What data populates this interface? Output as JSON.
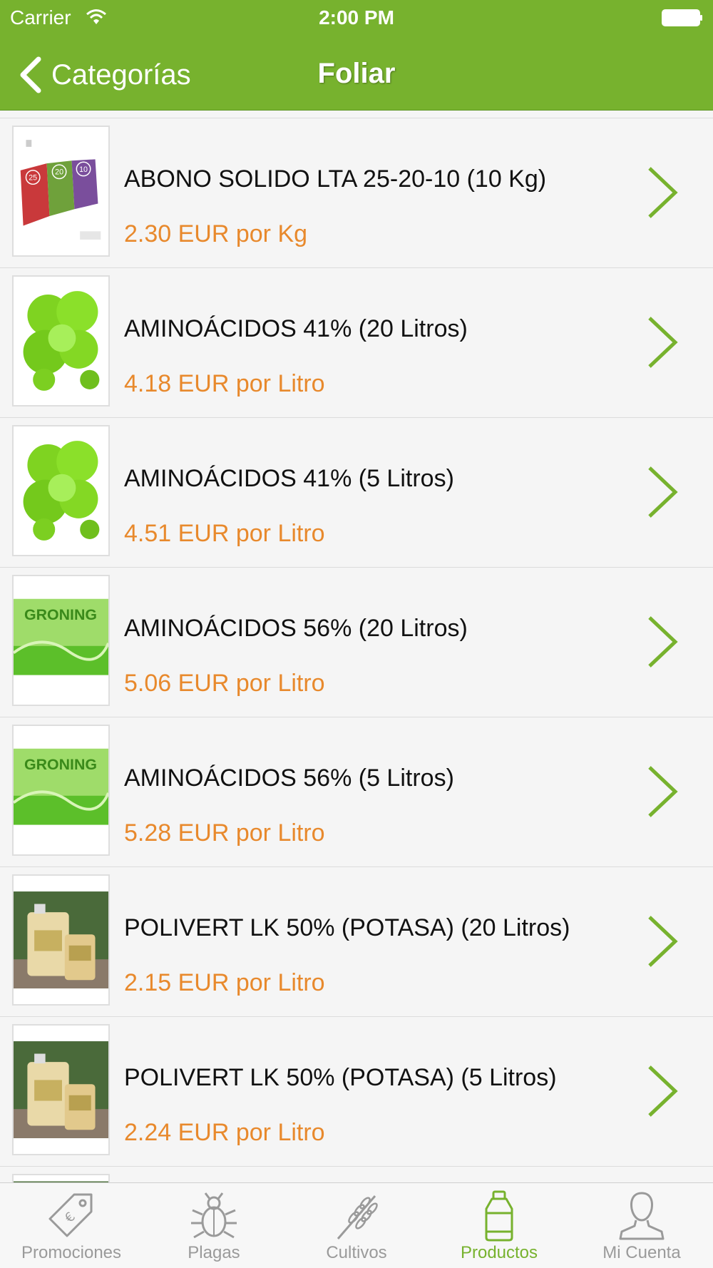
{
  "status_bar": {
    "carrier": "Carrier",
    "time": "2:00 PM"
  },
  "nav": {
    "back_label": "Categorías",
    "title": "Foliar"
  },
  "colors": {
    "brand_green": "#77b22e",
    "price_orange": "#e8892c"
  },
  "products": [
    {
      "name": "ABONO SOLIDO LTA 25-20-10 (10 Kg)",
      "price": "2.30 EUR por Kg",
      "thumb_icon": "fertilizer-bags-icon",
      "thumb_text": [
        "25",
        "20",
        "10"
      ]
    },
    {
      "name": "AMINOÁCIDOS 41% (20 Litros)",
      "price": "4.18 EUR por Litro",
      "thumb_icon": "green-clover-icon"
    },
    {
      "name": "AMINOÁCIDOS 41% (5 Litros)",
      "price": "4.51 EUR por Litro",
      "thumb_icon": "green-clover-icon"
    },
    {
      "name": "AMINOÁCIDOS 56% (20 Litros)",
      "price": "5.06 EUR por Litro",
      "thumb_icon": "groning-label-icon",
      "thumb_text": "GRONING"
    },
    {
      "name": "AMINOÁCIDOS 56% (5 Litros)",
      "price": "5.28 EUR por Litro",
      "thumb_icon": "groning-label-icon",
      "thumb_text": "GRONING"
    },
    {
      "name": "POLIVERT LK 50% (POTASA) (20 Litros)",
      "price": "2.15 EUR por Litro",
      "thumb_icon": "jerrycan-photo-icon"
    },
    {
      "name": "POLIVERT LK 50% (POTASA) (5 Litros)",
      "price": "2.24 EUR por Litro",
      "thumb_icon": "jerrycan-photo-icon"
    }
  ],
  "tabs": [
    {
      "label": "Promociones",
      "icon": "price-tag-icon",
      "active": false
    },
    {
      "label": "Plagas",
      "icon": "bug-icon",
      "active": false
    },
    {
      "label": "Cultivos",
      "icon": "wheat-icon",
      "active": false
    },
    {
      "label": "Productos",
      "icon": "bottle-icon",
      "active": true
    },
    {
      "label": "Mi Cuenta",
      "icon": "user-icon",
      "active": false
    }
  ]
}
